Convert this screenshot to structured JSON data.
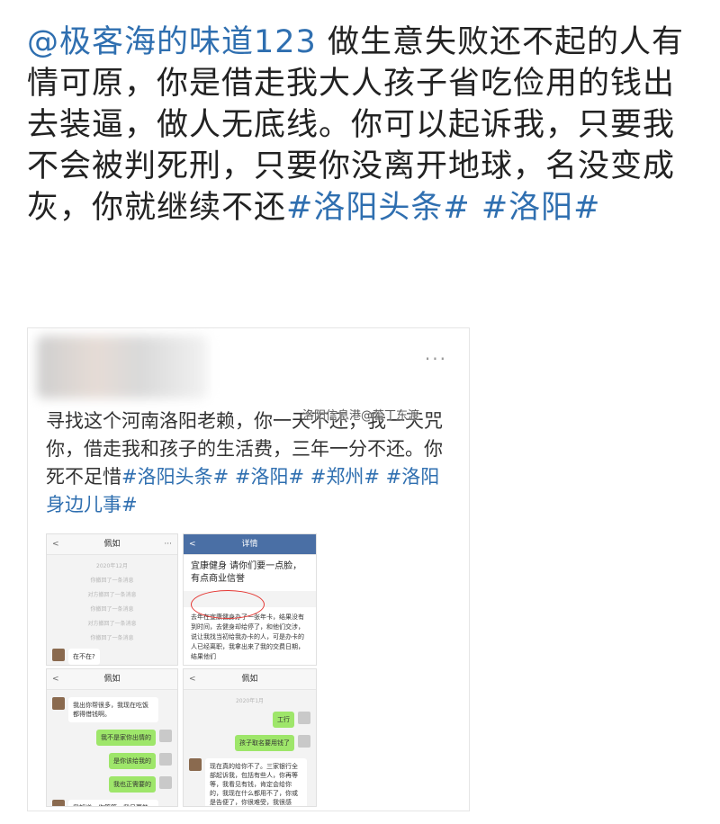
{
  "post": {
    "mention": "@极客海的味道123",
    "body": " 做生意失败还不起的人有情可原，你是借走我大人孩子省吃俭用的钱出去装逼，做人无底线。你可以起诉我，只要我不会被判死刑，只要你没离开地球，名没变成灰，你就继续不还",
    "tag1": "#洛阳头条#",
    "tag2": "#洛阳#"
  },
  "card": {
    "more_icon": "···",
    "watermark": "洛阳信息港@若丁东渡",
    "body": "寻找这个河南洛阳老赖，你一天不还，我一天咒你，借走我和孩子的生活费，三年一分不还。你死不足惜",
    "tags": [
      "#洛阳头条#",
      "#洛阳#",
      "#郑州#",
      "#洛阳身边儿事#"
    ]
  },
  "shots": {
    "s1": {
      "header_back": "<",
      "header_title": "佩如",
      "header_dots": "···",
      "sys": [
        "2020年12月",
        "你撤回了一条消息",
        "对方撤回了一条消息",
        "你撤回了一条消息",
        "对方撤回了一条消息",
        "你撤回了一条消息"
      ],
      "bubble": "在不在?"
    },
    "s2": {
      "header_back": "<",
      "header_title": "详情",
      "title": "宜康健身 请你们要一点脸，有点商业信誉",
      "body": "去年在宜康健身办了一张年卡，结果没有到时间，去健身却给停了，和他们交涉，说让我找当初给我办卡的人，可是办卡的人已经离职，我拿出来了我的交费日期，结果他们"
    },
    "s3": {
      "header_back": "<",
      "header_title": "佩如",
      "b1": "我出你帮很多，我现在吃饭都得借钱啊。",
      "b2": "我不是家你出情的",
      "b3": "是你该给我的",
      "b4": "我也正需要的",
      "b5": "我知道，你等等，我只要能有钱，我以性命担保，第一时间还你的"
    },
    "s4": {
      "header_back": "<",
      "header_title": "佩如",
      "sys": "2020年1月",
      "b1": "工行",
      "b2": "孩子取名要用钱了",
      "b3": "现在真的给你不了。三家银行全部起诉我，包括有些人，你再等等，我看见有钱，肯定会给你的，我现在什么都用不了，你或是告便了，你很难受，我很感谢，但现在真的是没办法，请你相信我。"
    }
  }
}
